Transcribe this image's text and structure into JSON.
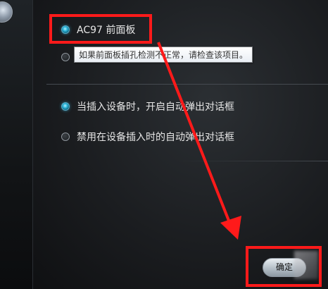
{
  "options": {
    "front_panel_label": "AC97 前面板",
    "front_panel_tooltip": "如果前面板插孔检测不正常，请检查该项目。",
    "autopopup_label": "当插入设备时，开启自动弹出对话框",
    "disable_popup_label": "禁用在设备插入时的自动弹出对话框"
  },
  "buttons": {
    "ok_label": "确定"
  },
  "colors": {
    "annotation_red": "#ff1a1a",
    "radio_selected": "#2fb8dc"
  }
}
